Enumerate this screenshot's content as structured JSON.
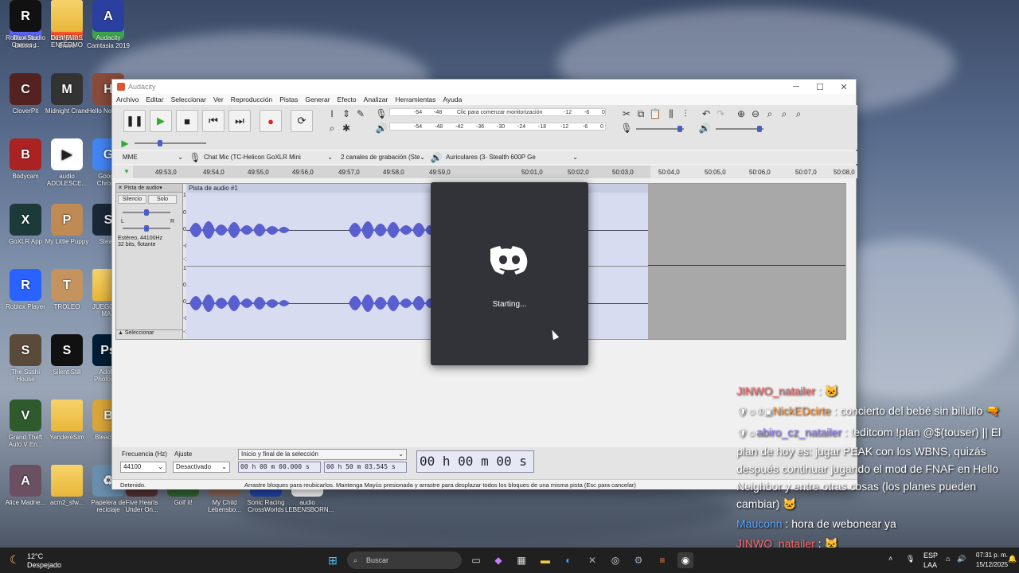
{
  "desktop": {
    "icons": [
      {
        "label": "Discord",
        "glyph": "D",
        "color": "#5865f2"
      },
      {
        "label": "Brave",
        "glyph": "B",
        "color": "#fb542b"
      },
      {
        "label": "Camtasia 2019",
        "glyph": "C",
        "color": "#3aa64a"
      },
      {
        "label": "CloverPit",
        "glyph": "C",
        "color": "#552222"
      },
      {
        "label": "Midnight Crane",
        "glyph": "M",
        "color": "#333333"
      },
      {
        "label": "Hello Neighbor",
        "glyph": "H",
        "color": "#8a4b3a"
      },
      {
        "label": "Bodycam",
        "glyph": "B",
        "color": "#aa2222"
      },
      {
        "label": "audio ADOLESCE...",
        "glyph": "▶",
        "color": "#ffffff"
      },
      {
        "label": "Google Chrome",
        "glyph": "G",
        "color": "#4285f4"
      },
      {
        "label": "GoXLR App",
        "glyph": "X",
        "color": "#1c3a3a"
      },
      {
        "label": "My Little Puppy",
        "glyph": "P",
        "color": "#c08a55"
      },
      {
        "label": "Steam",
        "glyph": "S",
        "color": "#1b2838"
      },
      {
        "label": "Roblox Player",
        "glyph": "R",
        "color": "#2962ff"
      },
      {
        "label": "TROLEO",
        "glyph": "T",
        "color": "#c4935e"
      },
      {
        "label": "JUEGOS Y MAS",
        "glyph": "",
        "color": "#f0c050"
      },
      {
        "label": "The Sushi House",
        "glyph": "S",
        "color": "#5a4a3a"
      },
      {
        "label": "Silent Still",
        "glyph": "S",
        "color": "#111111"
      },
      {
        "label": "Adobe Photosh...",
        "glyph": "Ps",
        "color": "#001e36"
      },
      {
        "label": "Grand Theft Auto V En...",
        "glyph": "V",
        "color": "#2e5a2e"
      },
      {
        "label": "YandereSim",
        "glyph": "",
        "color": "#f0c050"
      },
      {
        "label": "BleachBit",
        "glyph": "B",
        "color": "#d9a63a"
      },
      {
        "label": "Alice Madne...",
        "glyph": "A",
        "color": "#6a5060"
      },
      {
        "label": "acm2_sfw...",
        "glyph": "",
        "color": "#f0c050"
      },
      {
        "label": "Papelera de reciclaje",
        "glyph": "♻",
        "color": "#6a8fb0"
      },
      {
        "label": "Rockstar Games ...",
        "glyph": "R",
        "color": "#fcaf17"
      },
      {
        "label": "GEMELOS ENFERMO",
        "glyph": "",
        "color": "#f0c050"
      },
      {
        "label": "Audacity",
        "glyph": "A",
        "color": "#2a3fa0"
      },
      {
        "label": "Roblox Studio",
        "glyph": "R",
        "color": "#111111"
      },
      {
        "label": "Dust_Win...",
        "glyph": "",
        "color": "#f0c050"
      },
      {
        "label": "Five Hearts Under On...",
        "glyph": "F",
        "color": "#553333"
      },
      {
        "label": "Golf it!",
        "glyph": "G",
        "color": "#336633"
      },
      {
        "label": "My Child Lebensbo...",
        "glyph": "M",
        "color": "#886655"
      },
      {
        "label": "Sonic Racing CrossWorlds",
        "glyph": "S",
        "color": "#2244aa"
      },
      {
        "label": "audio LEBENSBORN...",
        "glyph": "▶",
        "color": "#ffffff"
      }
    ]
  },
  "audacity": {
    "title": "Audacity",
    "menu": [
      "Archivo",
      "Editar",
      "Seleccionar",
      "Ver",
      "Reproducción",
      "Pistas",
      "Generar",
      "Efecto",
      "Analizar",
      "Herramientas",
      "Ayuda"
    ],
    "meter_record_prompt": "Clic para comenzar monitorización",
    "meter_scale_top": [
      "-54",
      "-48",
      "-12",
      "-6",
      "0"
    ],
    "meter_scale_bottom": [
      "-54",
      "-48",
      "-42",
      "-36",
      "-30",
      "-24",
      "-18",
      "-12",
      "-6",
      "0"
    ],
    "meter_channels": [
      "L",
      "R",
      "L",
      "R"
    ],
    "host": "MME",
    "mic": "Chat Mic (TC-Helicon GoXLR Mini",
    "channels": "2 canales de grabación (Ste",
    "output": "Auriculares (3- Stealth 600P Ge",
    "ruler_ticks": [
      "49:53,0",
      "49:54,0",
      "49:55,0",
      "49:56,0",
      "49:57,0",
      "49:58,0",
      "49:59,0",
      "50:01,0",
      "50:02,0",
      "50:03,0",
      "50:04,0",
      "50:05,0",
      "50:06,0",
      "50:07,0",
      "50:08,0"
    ],
    "track": {
      "name_short": "Pista de audio",
      "clip_name": "Pista de audio #1",
      "mute": "Silencio",
      "solo": "Solo",
      "pan_l": "L",
      "pan_r": "R",
      "info1": "Estéreo, 44100Hz",
      "info2": "32 bits, flotante",
      "select": "Seleccionar",
      "scale": [
        "1,0",
        "0,5",
        "0,0",
        "-0,5",
        "-1,0",
        "1,0",
        "0,5",
        "0,0",
        "-0,5",
        "-1,0"
      ]
    },
    "bottom": {
      "rate_label": "Frecuencia (Hz)",
      "rate_value": "44100",
      "snap_label": "Ajuste",
      "snap_value": "Desactivado",
      "selection_label": "Inicio y final de la selección",
      "sel_start": "00 h 00 m 00.000 s",
      "sel_end": "00 h 50 m 03.545 s",
      "audio_position": "00 h 00 m 00 s"
    },
    "status_left": "Detenido.",
    "status_right": "Arrastre bloques para reubicarlos. Mantenga Mayús presionada y arrastre para desplazar todos los bloques de una misma pista (Esc para cancelar)"
  },
  "discord_splash": {
    "status": "Starting...",
    "accent": "#313338"
  },
  "chat": [
    {
      "user": "JINWO_natailer",
      "color": "#ff6b6b",
      "badges": "",
      "message": ": 🐱"
    },
    {
      "user": "NickEDcirte",
      "color": "#ff9a3c",
      "badges": "🛡☺①▣",
      "message": ": concierto del bebé sin billullo 🔫"
    },
    {
      "user": "abiro_cz_natailer",
      "color": "#9a7cff",
      "badges": "🛡☺",
      "message": ": !editcom !plan @$(touser) || El plan de hoy es: jugar PEAK con los WBNS, quizás después continuar jugando el mod de FNAF en Hello Neighbor y entre otras cosas (los planes pueden cambiar) 🐱"
    },
    {
      "user": "Mauconn",
      "color": "#5aa8ff",
      "badges": "",
      "message": ": hora de webonear ya"
    },
    {
      "user": "JINWO_natailer",
      "color": "#ff6b6b",
      "badges": "",
      "message": ": 🐱"
    }
  ],
  "taskbar": {
    "weather_temp": "12°C",
    "weather_desc": "Despejado",
    "search_placeholder": "Buscar",
    "lang": "ESP",
    "lang2": "LAA",
    "time": "07:31 p. m.",
    "date": "15/12/2025"
  }
}
